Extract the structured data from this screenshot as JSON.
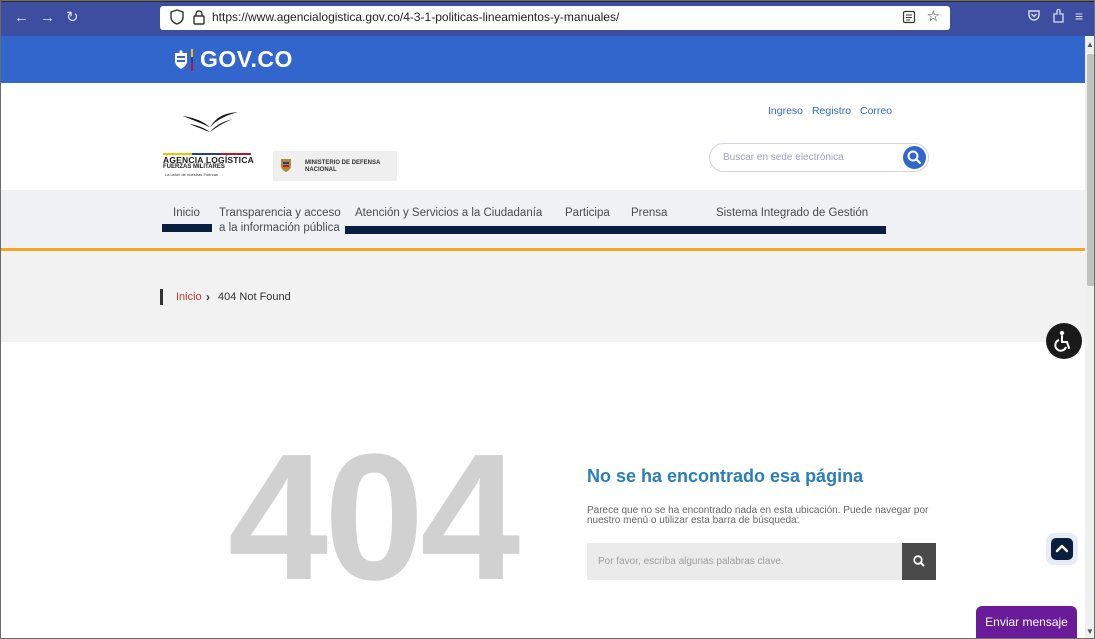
{
  "browser": {
    "url": "https://www.agencialogistica.gov.co/4-3-1-politicas-lineamientos-y-manuales/"
  },
  "gov_bar": {
    "brand": "GOV.CO"
  },
  "header": {
    "agency_name": "AGENCIA LOGÍSTICA",
    "agency_sub": "FUERZAS MILITARES",
    "agency_tag": "La unión de nuestras Fuerzas",
    "ministry_line1": "MINISTERIO DE DEFENSA",
    "ministry_line2": "NACIONAL",
    "links": [
      "Ingreso",
      "Registro",
      "Correo"
    ],
    "search_placeholder": "Buscar en sede electrónica"
  },
  "nav": {
    "items": [
      "Inicio",
      "Transparencia y acceso",
      "a la información pública",
      "Atención y Servicios a la Ciudadanía",
      "Participa",
      "Prensa",
      "Sistema Integrado de Gestión"
    ]
  },
  "breadcrumb": {
    "home": "Inicio",
    "separator": "›",
    "current": "404 Not Found"
  },
  "not_found": {
    "code": "404",
    "title": "No se ha encontrado esa página",
    "description": "Parece que no se ha encontrado nada en esta ubicación. Puede navegar por nuestro menú o utilizar esta barra de búsqueda:",
    "search_placeholder": "Por favor, escriba algunas palabras clave."
  },
  "widgets": {
    "chat_label": "Enviar mensaje"
  },
  "colors": {
    "gov_blue": "#3366cc",
    "nav_dark": "#0a1e3f",
    "accent_orange": "#f5a623",
    "title_blue": "#2b7fb8",
    "chat_purple": "#6a1b9a"
  }
}
